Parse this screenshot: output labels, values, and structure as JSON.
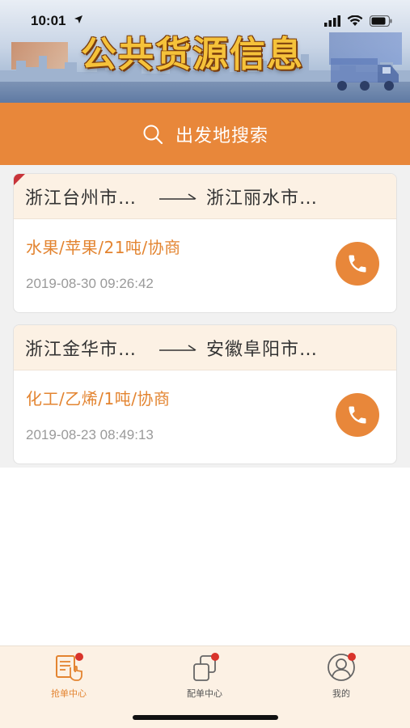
{
  "status_bar": {
    "time": "10:01"
  },
  "banner": {
    "title": "公共货源信息"
  },
  "search": {
    "label": "出发地搜索"
  },
  "listings": [
    {
      "origin": "浙江台州市…",
      "destination": "浙江丽水市…",
      "cargo": "水果/苹果/21吨/协商",
      "time": "2019-08-30 09:26:42",
      "flagged": true
    },
    {
      "origin": "浙江金华市…",
      "destination": "安徽阜阳市…",
      "cargo": "化工/乙烯/1吨/协商",
      "time": "2019-08-23 08:49:13",
      "flagged": false
    }
  ],
  "tabs": [
    {
      "label": "抢单中心",
      "icon": "grab-order-icon",
      "active": true
    },
    {
      "label": "配单中心",
      "icon": "dispatch-order-icon",
      "active": false
    },
    {
      "label": "我的",
      "icon": "profile-icon",
      "active": false
    }
  ],
  "colors": {
    "accent": "#e8873a",
    "cargo_text": "#e38430",
    "card_header": "#fcf1e4",
    "badge": "#d9342b"
  }
}
